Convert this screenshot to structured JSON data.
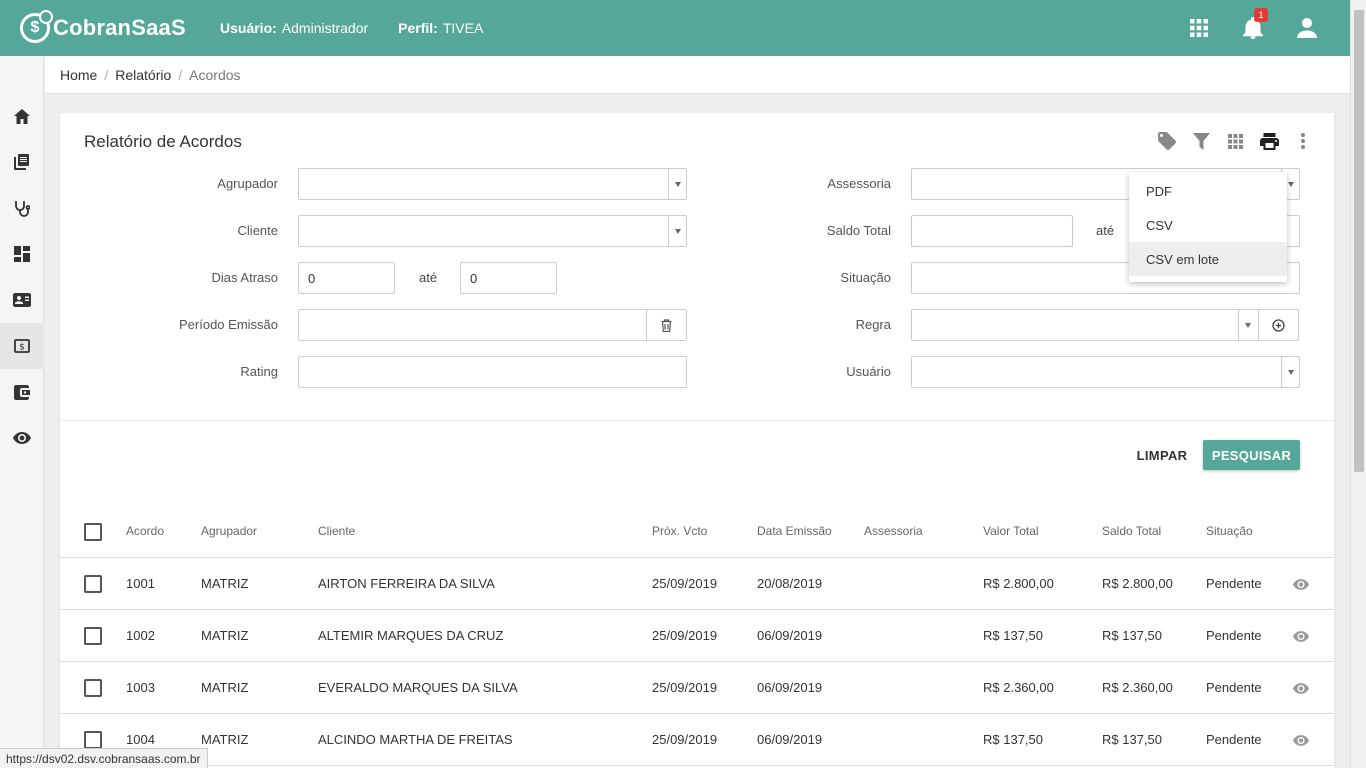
{
  "header": {
    "logo_text": "CobranSaaS",
    "user_label": "Usuário:",
    "user_value": "Administrador",
    "profile_label": "Perfil:",
    "profile_value": "TIVEA",
    "notification_count": "1",
    "accent_color": "#55a899"
  },
  "breadcrumb": [
    "Home",
    "Relatório",
    "Acordos"
  ],
  "sidebar": {
    "icons": [
      "home-icon",
      "book-icon",
      "stethoscope-icon",
      "dashboard-icon",
      "contact-card-icon",
      "money-icon",
      "wallet-icon",
      "eye-icon"
    ],
    "active_index": 5
  },
  "card": {
    "title": "Relatório de Acordos",
    "actions": [
      "tag-icon",
      "filter-icon",
      "grid-icon",
      "print-icon",
      "more-vert-icon"
    ]
  },
  "filters": {
    "agrupador": "Agrupador",
    "cliente": "Cliente",
    "dias_atraso": "Dias Atraso",
    "dias_atraso_from": "0",
    "dias_atraso_to": "0",
    "ate": "até",
    "periodo_emissao": "Período Emissão",
    "rating": "Rating",
    "assessoria": "Assessoria",
    "saldo_total": "Saldo Total",
    "situacao": "Situação",
    "regra": "Regra",
    "usuario": "Usuário"
  },
  "buttons": {
    "limpar": "LIMPAR",
    "pesquisar": "PESQUISAR"
  },
  "print_menu": {
    "items": [
      "PDF",
      "CSV",
      "CSV em lote"
    ],
    "highlighted_index": 2
  },
  "table": {
    "columns": [
      "Acordo",
      "Agrupador",
      "Cliente",
      "Próx. Vcto",
      "Data Emissão",
      "Assessoria",
      "Valor Total",
      "Saldo Total",
      "Situação"
    ],
    "rows": [
      {
        "acordo": "1001",
        "agrupador": "MATRIZ",
        "cliente": "AIRTON FERREIRA DA SILVA",
        "prox_vcto": "25/09/2019",
        "data_emissao": "20/08/2019",
        "assessoria": "",
        "valor_total": "R$ 2.800,00",
        "saldo_total": "R$ 2.800,00",
        "situacao": "Pendente"
      },
      {
        "acordo": "1002",
        "agrupador": "MATRIZ",
        "cliente": "ALTEMIR MARQUES DA CRUZ",
        "prox_vcto": "25/09/2019",
        "data_emissao": "06/09/2019",
        "assessoria": "",
        "valor_total": "R$ 137,50",
        "saldo_total": "R$ 137,50",
        "situacao": "Pendente"
      },
      {
        "acordo": "1003",
        "agrupador": "MATRIZ",
        "cliente": "EVERALDO MARQUES DA SILVA",
        "prox_vcto": "25/09/2019",
        "data_emissao": "06/09/2019",
        "assessoria": "",
        "valor_total": "R$ 2.360,00",
        "saldo_total": "R$ 2.360,00",
        "situacao": "Pendente"
      },
      {
        "acordo": "1004",
        "agrupador": "MATRIZ",
        "cliente": "ALCINDO MARTHA DE FREITAS",
        "prox_vcto": "25/09/2019",
        "data_emissao": "06/09/2019",
        "assessoria": "",
        "valor_total": "R$ 137,50",
        "saldo_total": "R$ 137,50",
        "situacao": "Pendente"
      }
    ]
  },
  "status_bar_url": "https://dsv02.dsv.cobransaas.com.br"
}
